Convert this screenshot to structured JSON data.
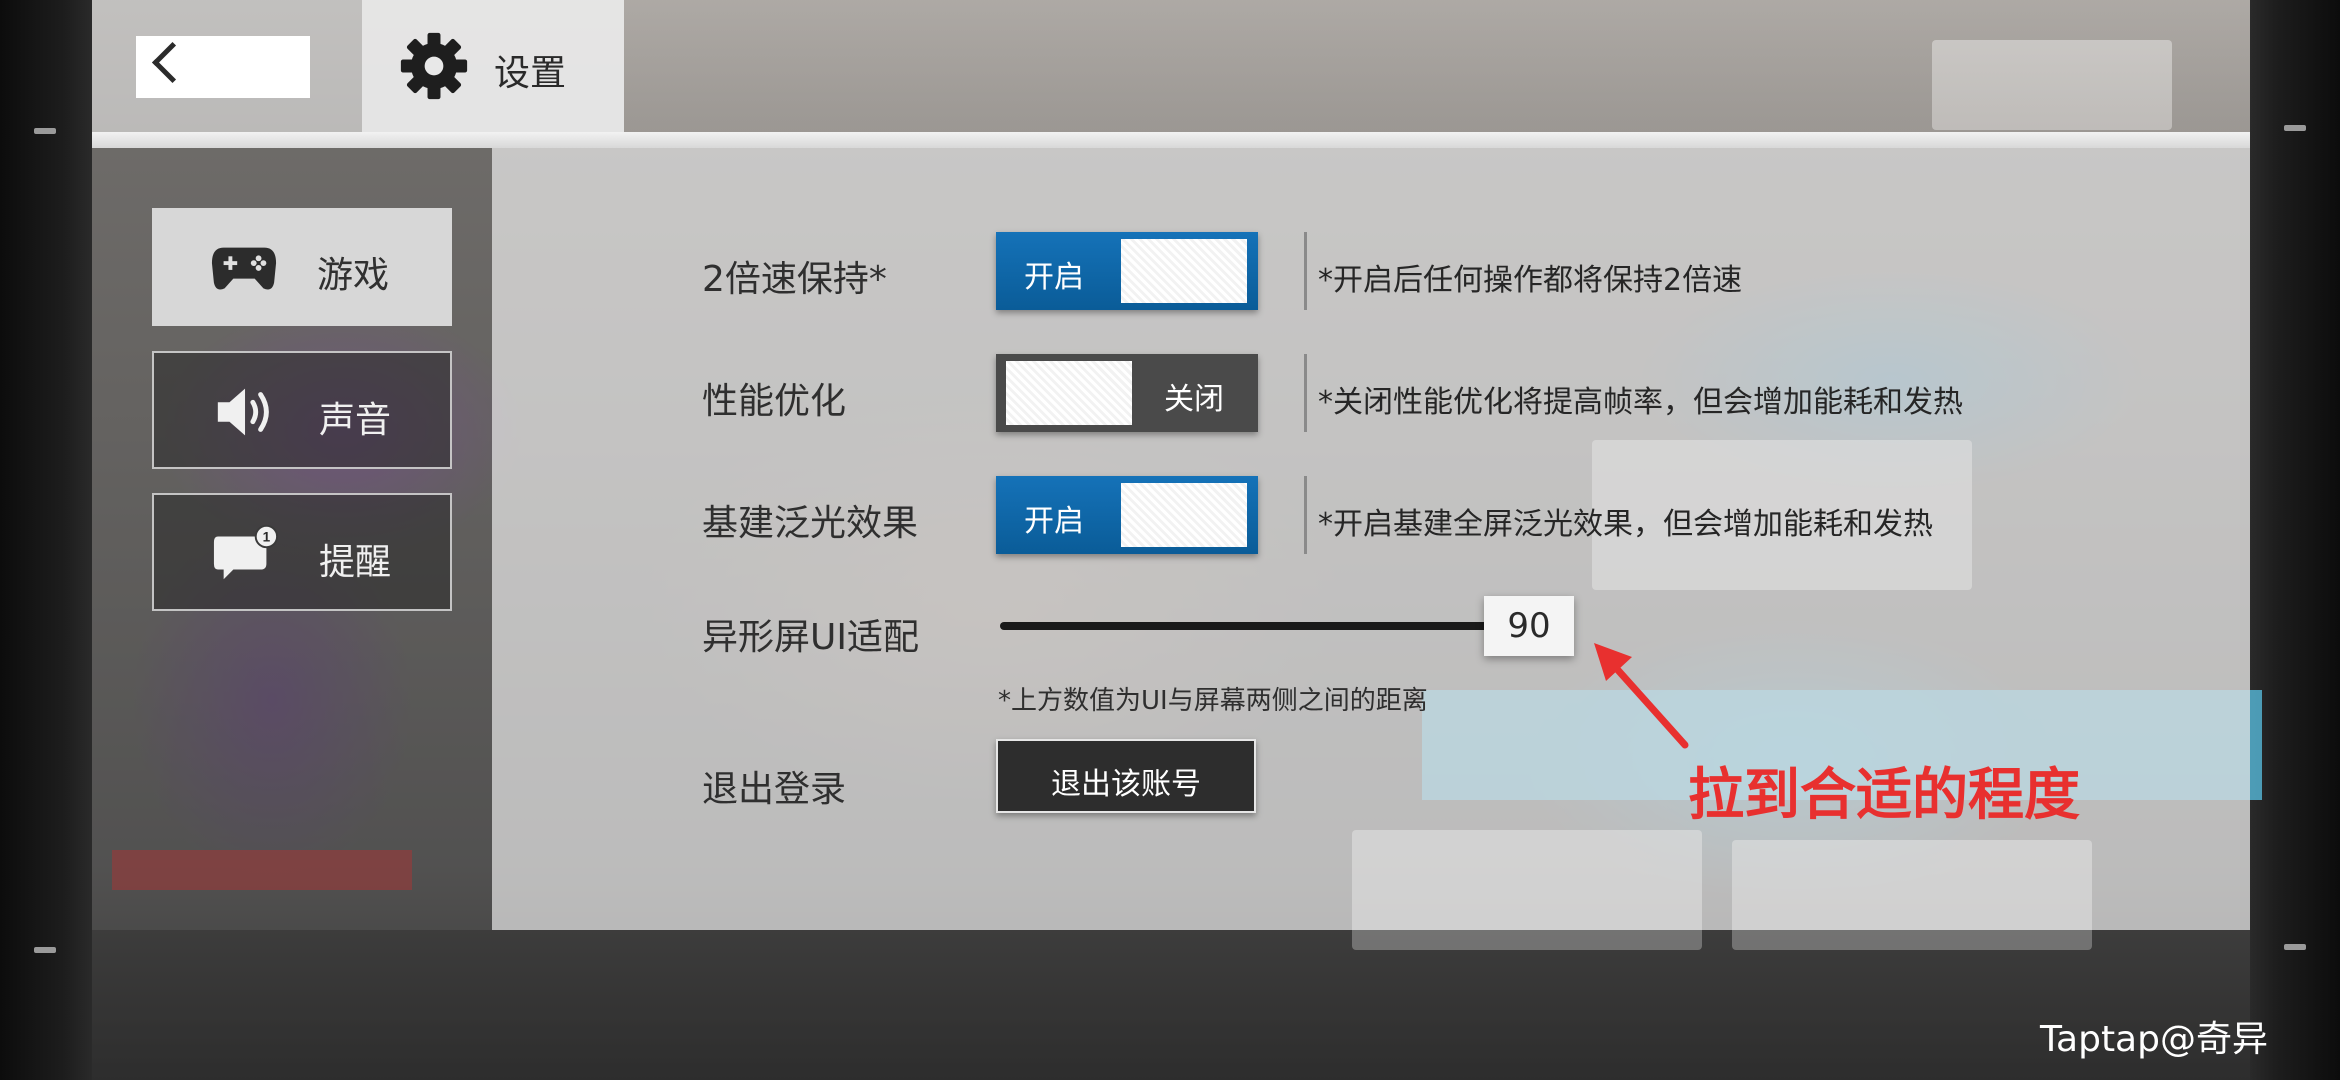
{
  "header": {
    "back_icon": "chevron-left-icon",
    "settings_icon": "gear-icon",
    "title": "设置"
  },
  "sidebar": {
    "items": [
      {
        "label": "游戏",
        "icon": "gamepad-icon",
        "active": true
      },
      {
        "label": "声音",
        "icon": "speaker-icon",
        "active": false
      },
      {
        "label": "提醒",
        "icon": "chat-notification-icon",
        "active": false,
        "badge": "1"
      }
    ]
  },
  "settings": {
    "speed_keep": {
      "label": "2倍速保持*",
      "state_label": "开启",
      "on": true,
      "desc": "*开启后任何操作都将保持2倍速"
    },
    "performance": {
      "label": "性能优化",
      "state_label": "关闭",
      "on": false,
      "desc": "*关闭性能优化将提高帧率，但会增加能耗和发热"
    },
    "bloom": {
      "label": "基建泛光效果",
      "state_label": "开启",
      "on": true,
      "desc": "*开启基建全屏泛光效果，但会增加能耗和发热"
    },
    "notch_ui": {
      "label": "异形屏UI适配",
      "value": "90",
      "note": "*上方数值为UI与屏幕两侧之间的距离"
    },
    "logout": {
      "label": "退出登录",
      "button_label": "退出该账号"
    }
  },
  "annotation": {
    "text": "拉到合适的程度",
    "color": "#e8302f"
  },
  "watermark": "Taptap@奇异",
  "colors": {
    "toggle_on": "#1572b8",
    "toggle_off": "#4a4a4a",
    "button_dark": "#2d2d2d"
  }
}
